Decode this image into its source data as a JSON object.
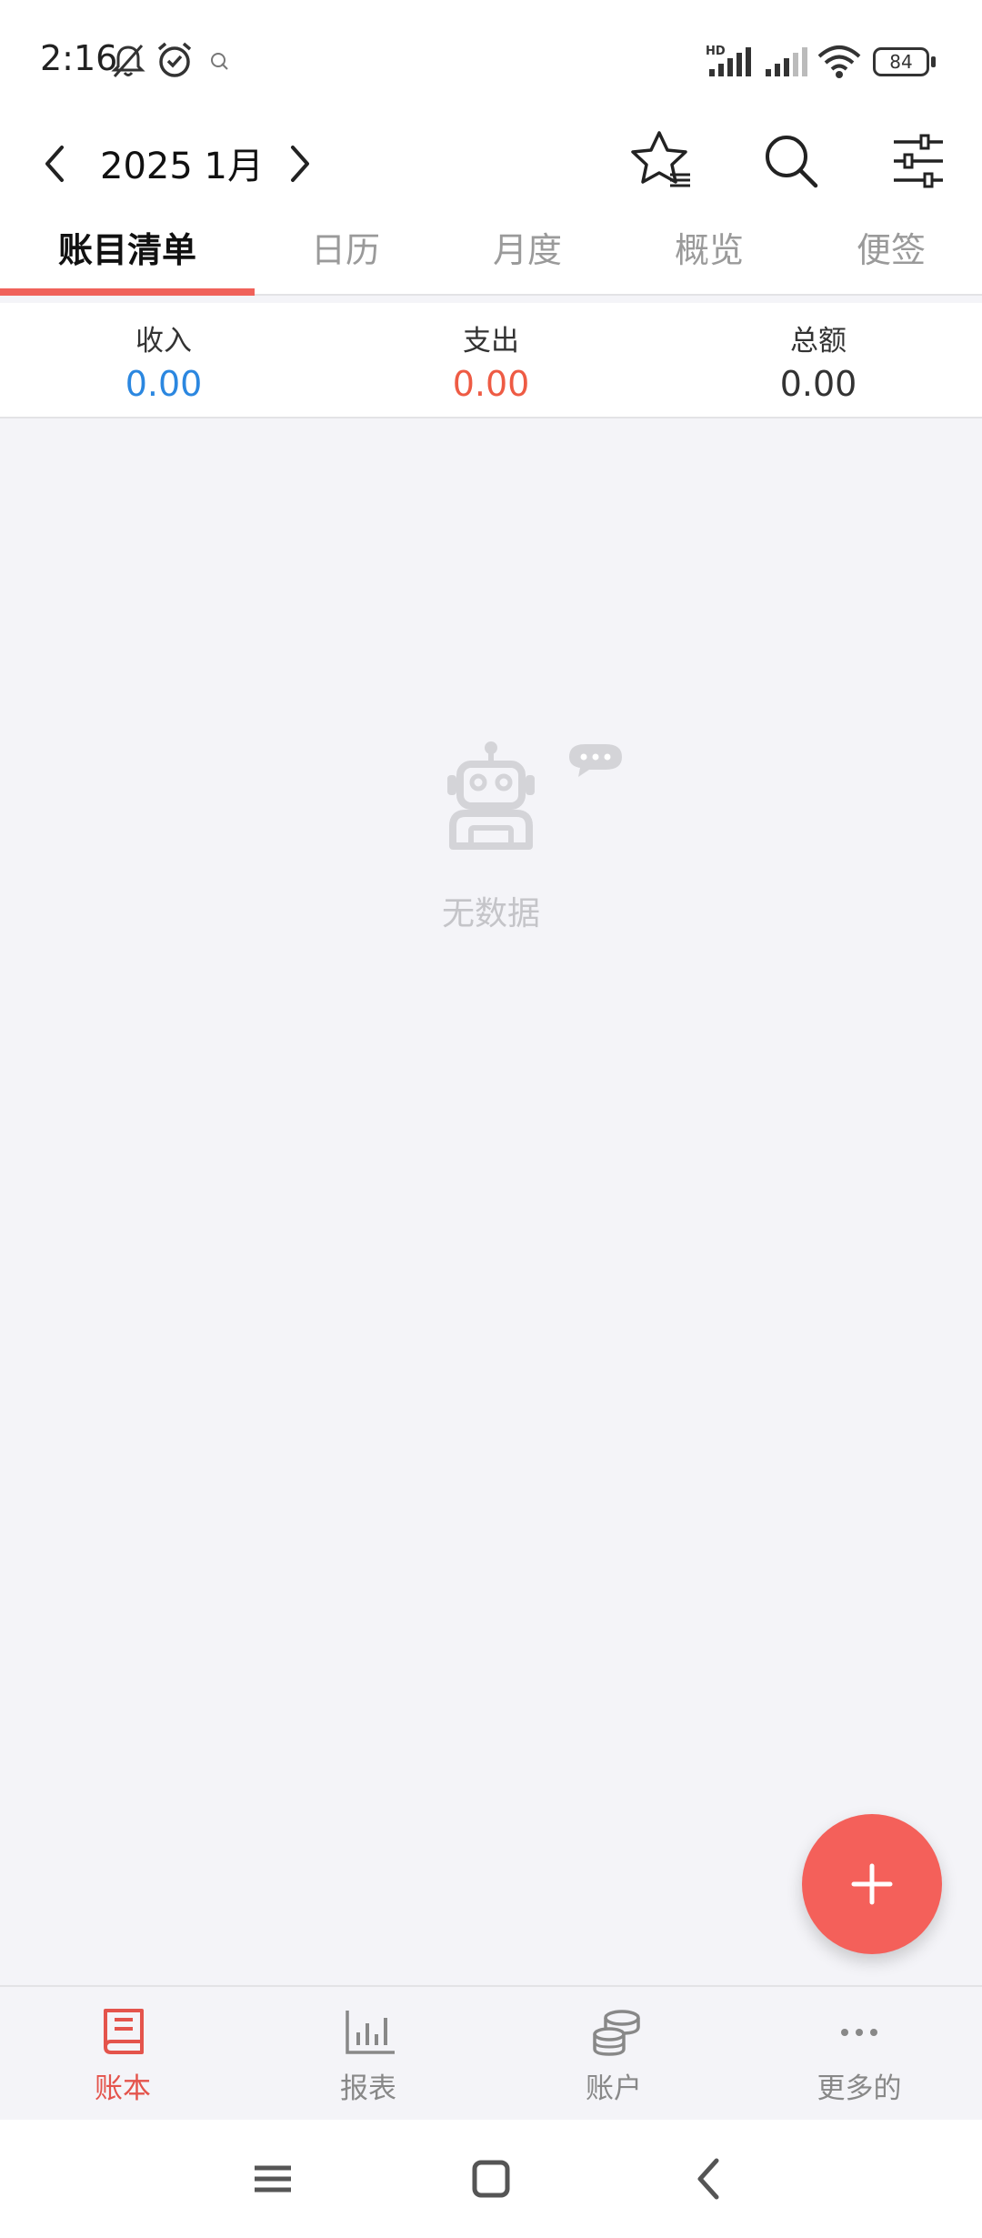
{
  "status_bar": {
    "time": "2:16",
    "battery": "84",
    "icons": [
      "bell-off-icon",
      "alarm-icon",
      "notification-icon",
      "hd-signal-icon",
      "signal-icon",
      "wifi-icon",
      "battery-icon"
    ]
  },
  "header": {
    "period_title": "2025 1月",
    "actions": [
      "favorites-icon",
      "search-icon",
      "filter-icon"
    ]
  },
  "tabs": [
    {
      "label": "账目清单",
      "active": true
    },
    {
      "label": "日历",
      "active": false
    },
    {
      "label": "月度",
      "active": false
    },
    {
      "label": "概览",
      "active": false
    },
    {
      "label": "便签",
      "active": false
    }
  ],
  "summary": {
    "income": {
      "label": "收入",
      "value": "0.00",
      "color": "#2b87e0"
    },
    "expense": {
      "label": "支出",
      "value": "0.00",
      "color": "#ee5b44"
    },
    "total": {
      "label": "总额",
      "value": "0.00",
      "color": "#333333"
    }
  },
  "empty_state": {
    "text": "无数据",
    "icon": "robot-icon"
  },
  "fab": {
    "icon": "plus-icon"
  },
  "bottom_nav": [
    {
      "label": "账本",
      "icon": "ledger-book-icon",
      "active": true
    },
    {
      "label": "报表",
      "icon": "bar-chart-icon",
      "active": false
    },
    {
      "label": "账户",
      "icon": "coins-stack-icon",
      "active": false
    },
    {
      "label": "更多的",
      "icon": "more-dots-icon",
      "active": false
    }
  ],
  "colors": {
    "accent": "#f0625a",
    "income": "#2b87e0",
    "expense": "#ee5b44"
  }
}
